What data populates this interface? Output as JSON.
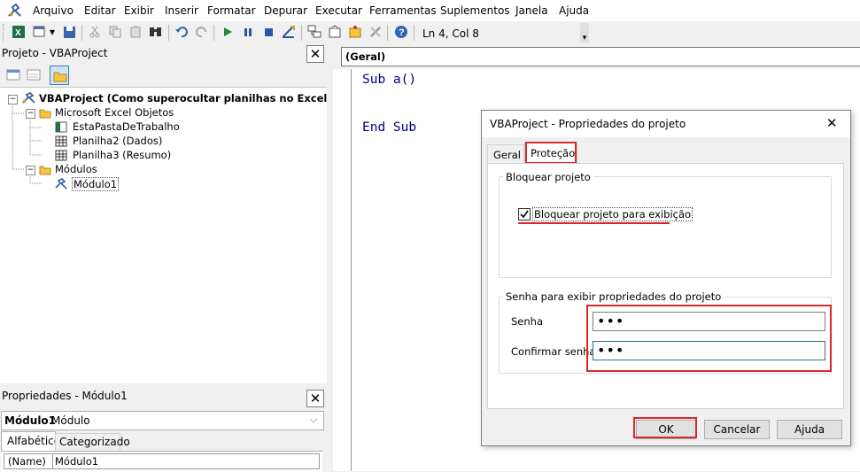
{
  "menu": {
    "items": [
      "Arquivo",
      "Editar",
      "Exibir",
      "Inserir",
      "Formatar",
      "Depurar",
      "Executar",
      "Ferramentas",
      "Suplementos",
      "Janela",
      "Ajuda"
    ]
  },
  "toolbar": {
    "position_text": "Ln 4, Col 8"
  },
  "project_pane": {
    "title": "Projeto - VBAProject",
    "close": "✕",
    "root": "VBAProject (Como superocultar planilhas no Excel.xls...)",
    "folder_objects": "Microsoft Excel Objetos",
    "workbook": "EstaPastaDeTrabalho",
    "sheet2": "Planilha2 (Dados)",
    "sheet3": "Planilha3 (Resumo)",
    "folder_modules": "Módulos",
    "module1": "Módulo1"
  },
  "properties_pane": {
    "title": "Propriedades - Módulo1",
    "close": "✕",
    "object_name": "Módulo1",
    "object_type": "Módulo",
    "tab_alpha": "Alfabético",
    "tab_cat": "Categorizado",
    "prop_name": "(Name)",
    "prop_value": "Módulo1"
  },
  "code": {
    "combo": "(Geral)",
    "line1": "Sub a()",
    "line2": "End Sub"
  },
  "dialog": {
    "title": "VBAProject - Propriedades do projeto",
    "close": "✕",
    "tab_general": "Geral",
    "tab_protection": "Proteção",
    "group_lock": "Bloquear projeto",
    "checkbox_label": "Bloquear projeto para exibição",
    "checkbox_checked": true,
    "group_password": "Senha para exibir propriedades do projeto",
    "password_label": "Senha",
    "password_value": "•••",
    "confirm_label": "Confirmar senha",
    "confirm_value": "•••",
    "ok_label": "OK",
    "cancel_label": "Cancelar",
    "help_label": "Ajuda"
  },
  "colors": {
    "highlight": "#d9272e",
    "code_keyword": "#00007f"
  }
}
